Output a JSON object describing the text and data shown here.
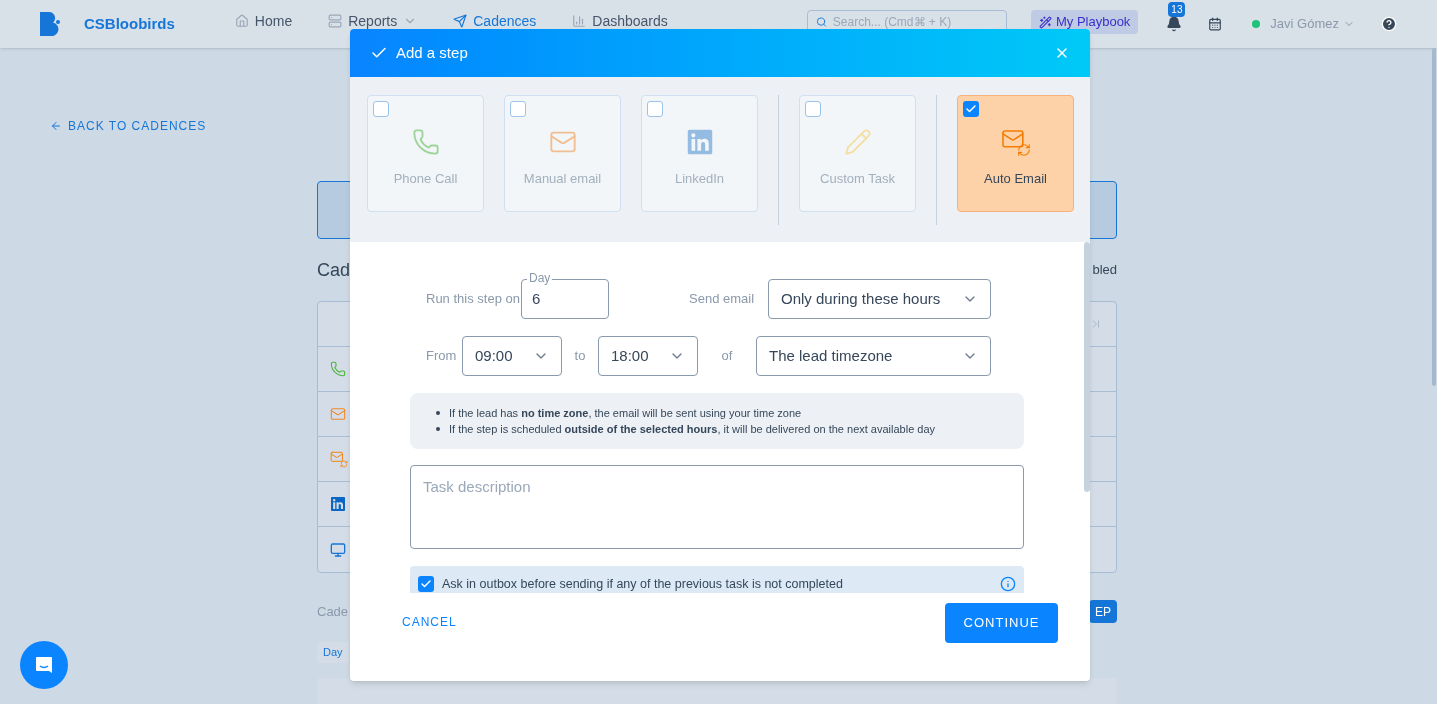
{
  "nav": {
    "brand": "CSBloobirds",
    "items": [
      {
        "label": "Home",
        "kind": "home",
        "selected": false
      },
      {
        "label": "Reports",
        "kind": "reports",
        "selected": false
      },
      {
        "label": "Cadences",
        "kind": "cadences",
        "selected": true
      },
      {
        "label": "Dashboards",
        "kind": "dashboards",
        "selected": false
      }
    ],
    "search": {
      "placeholder": "Search... (Cmd⌘ + K)"
    },
    "playbook": "My Playbook",
    "notifications": "13",
    "user": {
      "name": "Javi Gómez",
      "online": true
    }
  },
  "page": {
    "back_link": "BACK TO CADENCES",
    "title": "Cad",
    "status": "bled",
    "step_rows": [
      {
        "kind": "phone"
      },
      {
        "kind": "email"
      },
      {
        "kind": "auto_email"
      },
      {
        "kind": "linkedin"
      },
      {
        "kind": "task"
      }
    ],
    "section_label": "Cade",
    "add_button": "EP",
    "day_tag": "Day"
  },
  "modal": {
    "title": "Add a step",
    "step_types": [
      {
        "label": "Phone Call",
        "kind": "phone",
        "checked": false
      },
      {
        "label": "Manual email",
        "kind": "email",
        "checked": false
      },
      {
        "label": "LinkedIn",
        "kind": "linkedin",
        "checked": false
      },
      {
        "label": "Custom Task",
        "kind": "task",
        "checked": false
      },
      {
        "label": "Auto Email",
        "kind": "auto_email",
        "checked": true
      }
    ],
    "run_label": "Run this step on",
    "day": {
      "label": "Day",
      "value": "6"
    },
    "send_label": "Send email",
    "send_mode": "Only during these hours",
    "from_label": "From",
    "from": "09:00",
    "to_label": "to",
    "to": "18:00",
    "of_label": "of",
    "timezone": "The lead timezone",
    "notes": [
      "If the lead has **no time zone**, the email will be sent using your time zone",
      "If the step is scheduled **outside of the selected hours**, it will be delivered on the next available day"
    ],
    "description": {
      "placeholder": "Task description"
    },
    "ask_outbox": {
      "label": "Ask in outbox before sending if any of the previous task is not completed",
      "checked": true
    },
    "cancel": "CANCEL",
    "continue": "CONTINUE"
  }
}
